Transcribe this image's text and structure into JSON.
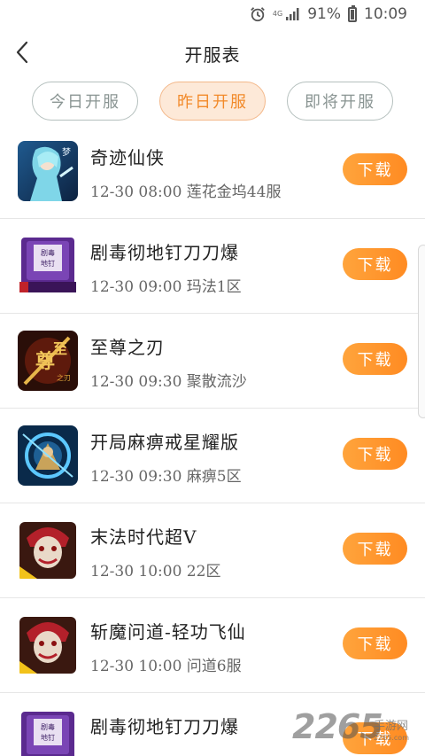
{
  "status_bar": {
    "network": "4G",
    "battery_percent": "91%",
    "time": "10:09",
    "icons": [
      "alarm-icon",
      "signal-icon",
      "battery-icon"
    ]
  },
  "header": {
    "title": "开服表",
    "back_icon": "chevron-left-icon"
  },
  "tabs": [
    {
      "label": "今日开服",
      "active": false
    },
    {
      "label": "昨日开服",
      "active": true
    },
    {
      "label": "即将开服",
      "active": false
    }
  ],
  "games": [
    {
      "name": "奇迹仙侠",
      "info": "12-30 08:00 莲花金坞44服",
      "action": "下载",
      "icon": "game-icon-fairy-swordsman"
    },
    {
      "name": "剧毒彻地钉刀刀爆",
      "info": "12-30 09:00 玛法1区",
      "action": "下载",
      "icon": "game-icon-purple-book"
    },
    {
      "name": "至尊之刃",
      "info": "12-30 09:30 聚散流沙",
      "action": "下载",
      "icon": "game-icon-golden-blade"
    },
    {
      "name": "开局麻痹戒星耀版",
      "info": "12-30 09:30 麻痹5区",
      "action": "下载",
      "icon": "game-icon-blue-warrior"
    },
    {
      "name": "末法时代超V",
      "info": "12-30 10:00 22区",
      "action": "下载",
      "icon": "game-icon-clown"
    },
    {
      "name": " 斩魔问道-轻功飞仙",
      "info": "12-30 10:00 问道6服",
      "action": "下载",
      "icon": "game-icon-clown"
    },
    {
      "name": "剧毒彻地钉刀刀爆",
      "info": "",
      "action": "下载",
      "icon": "game-icon-purple-book"
    }
  ],
  "watermark": {
    "number": "2265",
    "text": "手游网",
    "url": "2265.com"
  },
  "colors": {
    "accent": "#ff9530",
    "tab_active_bg": "#fde9d8",
    "tab_border": "#b5c0be"
  }
}
